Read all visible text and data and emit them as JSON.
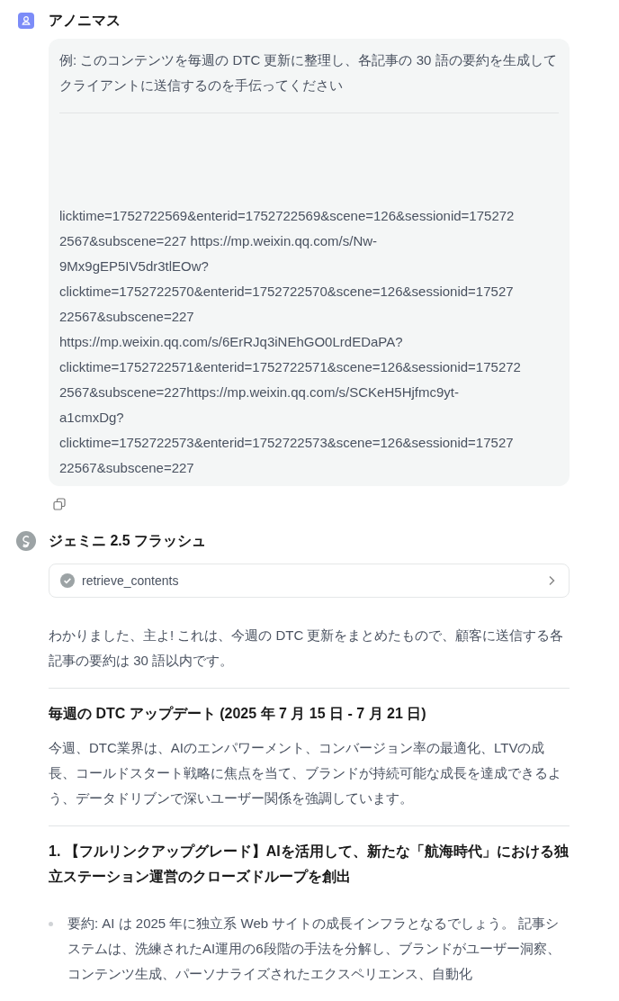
{
  "messages": [
    {
      "kind": "user",
      "author": "アノニマス",
      "prompt": "例: このコンテンツを毎週の DTC 更新に整理し、各記事の 30 語の要約を生成してクライアントに送信するのを手伝ってください",
      "url_lines": [
        "licktime=1752722569&enterid=1752722569&scene=126&sessionid=175272",
        "2567&subscene=227 https://mp.weixin.qq.com/s/Nw-",
        "9Mx9gEP5IV5dr3tlEOw?",
        "clicktime=1752722570&enterid=1752722570&scene=126&sessionid=17527",
        "22567&subscene=227",
        "https://mp.weixin.qq.com/s/6ErRJq3iNEhGO0LrdEDaPA?",
        "clicktime=1752722571&enterid=1752722571&scene=126&sessionid=175272",
        "2567&subscene=227https://mp.weixin.qq.com/s/SCKeH5Hjfmc9yt-",
        "a1cmxDg?",
        "clicktime=1752722573&enterid=1752722573&scene=126&sessionid=17527",
        "22567&subscene=227"
      ]
    },
    {
      "kind": "assistant",
      "author": "ジェミニ 2.5 フラッシュ",
      "tool": {
        "name": "retrieve_contents",
        "done": true
      },
      "blocks": [
        {
          "kind": "para",
          "text": "わかりました、主よ! これは、今週の DTC 更新をまとめたもので、顧客に送信する各記事の要約は 30 語以内です。"
        },
        {
          "kind": "rule"
        },
        {
          "kind": "heading",
          "text": "毎週の DTC アップデート (2025 年 7 月 15 日 - 7 月 21 日)"
        },
        {
          "kind": "para",
          "text": "今週、DTC業界は、AIのエンパワーメント、コンバージョン率の最適化、LTVの成長、コールドスタート戦略に焦点を当て、ブランドが持続可能な成長を達成できるよう、データドリブンで深いユーザー関係を強調しています。"
        },
        {
          "kind": "rule"
        },
        {
          "kind": "heading",
          "text": "1. 【フルリンクアップグレード】AIを活用して、新たな「航海時代」における独立ステーション運営のクローズドループを創出"
        },
        {
          "kind": "bullet",
          "text": "要約: AI は 2025 年に独立系 Web サイトの成長インフラとなるでしょう。 記事システムは、洗練されたAI運用の6段階の手法を分解し、ブランドがユーザー洞察、コンテンツ生成、パーソナライズされたエクスペリエンス、自動化"
        }
      ]
    }
  ]
}
